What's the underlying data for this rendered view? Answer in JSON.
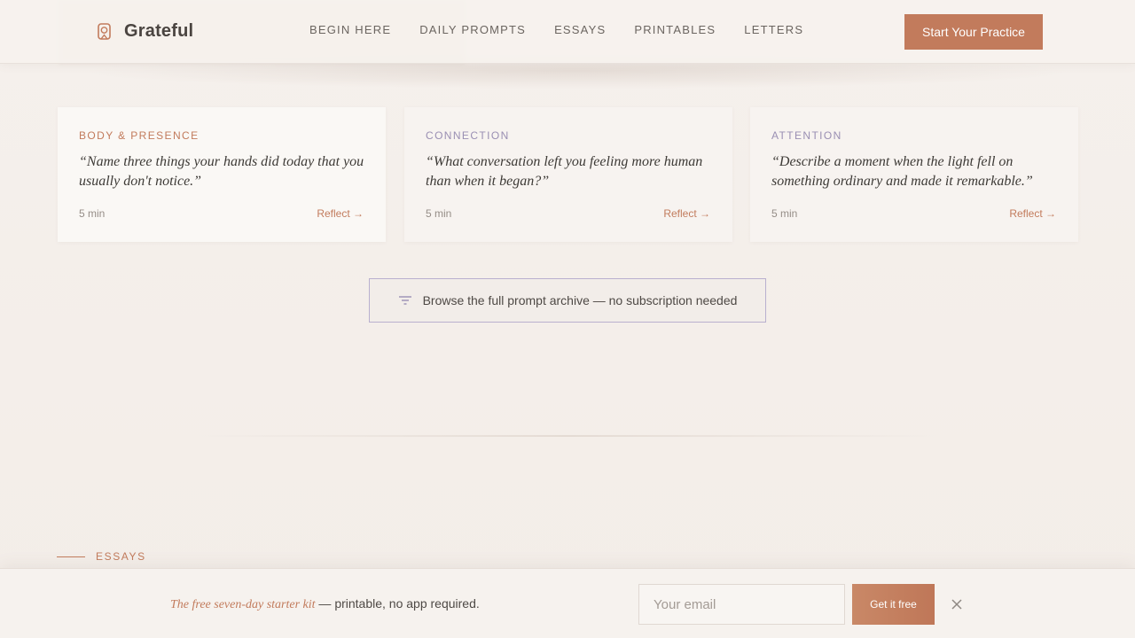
{
  "header": {
    "logo_text": "Grateful",
    "nav": [
      {
        "label": "BEGIN HERE"
      },
      {
        "label": "DAILY PROMPTS"
      },
      {
        "label": "ESSAYS"
      },
      {
        "label": "PRINTABLES"
      },
      {
        "label": "LETTERS"
      }
    ],
    "cta_label": "Start Your Practice"
  },
  "cards": [
    {
      "category": "BODY & PRESENCE",
      "quote": "“Name three things your hands did today that you usually don't notice.”",
      "time": "5 min",
      "link": "Reflect →"
    },
    {
      "category": "CONNECTION",
      "quote": "“What conversation left you feeling more human than when it began?”",
      "time": "5 min",
      "link": "Reflect →"
    },
    {
      "category": "ATTENTION",
      "quote": "“Describe a moment when the light fell on something ordinary and made it remarkable.”",
      "time": "5 min",
      "link": "Reflect →"
    }
  ],
  "archive_label": "Browse the full prompt archive — no subscription needed",
  "section_label": "ESSAYS",
  "bottom_bar": {
    "promo_em": "The free seven-day starter kit",
    "promo_rest": " — printable, no app required.",
    "email_placeholder": "Your email",
    "button_label": "Get it free"
  },
  "colors": {
    "accent": "#c27b5c",
    "secondary": "#9a8fb3",
    "background": "#f5f0ec"
  }
}
